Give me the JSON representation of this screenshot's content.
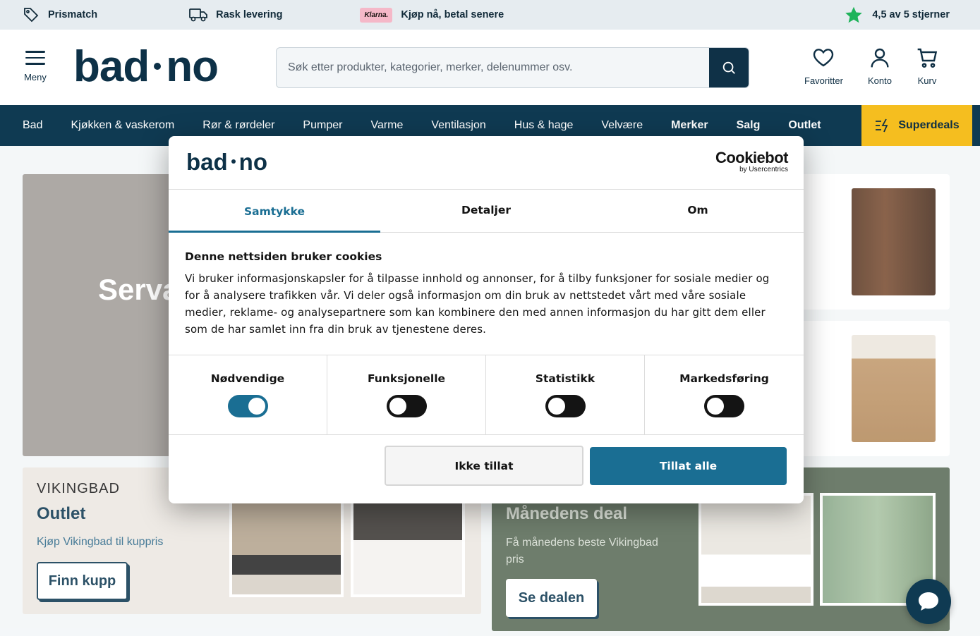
{
  "usp": {
    "items": [
      "Prismatch",
      "Rask levering",
      "Kjøp nå, betal senere",
      "4,5 av 5 stjerner"
    ],
    "klarna_badge": "Klarna."
  },
  "header": {
    "menu_label": "Meny",
    "logo_left": "bad",
    "logo_right": "no",
    "search_placeholder": "Søk etter produkter, kategorier, merker, delenummer osv.",
    "favorites": "Favoritter",
    "account": "Konto",
    "cart": "Kurv"
  },
  "nav": {
    "items": [
      "Bad",
      "Kjøkken & vaskerom",
      "Rør & rørdeler",
      "Pumper",
      "Varme",
      "Ventilasjon",
      "Hus & hage",
      "Velvære",
      "Merker",
      "Salg",
      "Outlet"
    ],
    "superdeals": "Superdeals"
  },
  "hero": {
    "title": "Serva"
  },
  "outlet": {
    "brand": "VIKINGBAD",
    "title": "Outlet",
    "subtitle": "Kjøp Vikingbad til kuppris",
    "button": "Finn kupp"
  },
  "deal": {
    "title": "Månedens deal",
    "subtitle": "Få månedens beste Vikingbad pris",
    "button": "Se dealen"
  },
  "cookie_dialog": {
    "logo_left": "bad",
    "logo_right": "no",
    "provider": "Cookiebot",
    "provider_sub": "by Usercentrics",
    "tabs": [
      "Samtykke",
      "Detaljer",
      "Om"
    ],
    "active_tab": "Samtykke",
    "heading": "Denne nettsiden bruker cookies",
    "body": "Vi bruker informasjonskapsler for å tilpasse innhold og annonser, for å tilby funksjoner for sosiale medier og for å analysere trafikken vår. Vi deler også informasjon om din bruk av nettstedet vårt med våre sosiale medier, reklame- og analysepartnere som kan kombinere den med annen informasjon du har gitt dem eller som de har samlet inn fra din bruk av tjenestene deres.",
    "toggles": [
      {
        "label": "Nødvendige",
        "on": true
      },
      {
        "label": "Funksjonelle",
        "on": false
      },
      {
        "label": "Statistikk",
        "on": false
      },
      {
        "label": "Markedsføring",
        "on": false
      }
    ],
    "deny_button": "Ikke tillat",
    "allow_button": "Tillat alle"
  },
  "colors": {
    "brand_dark": "#0f3a52",
    "accent_yellow": "#f5be1f",
    "cookie_blue": "#1a6e93",
    "star_green": "#1fb35a"
  }
}
